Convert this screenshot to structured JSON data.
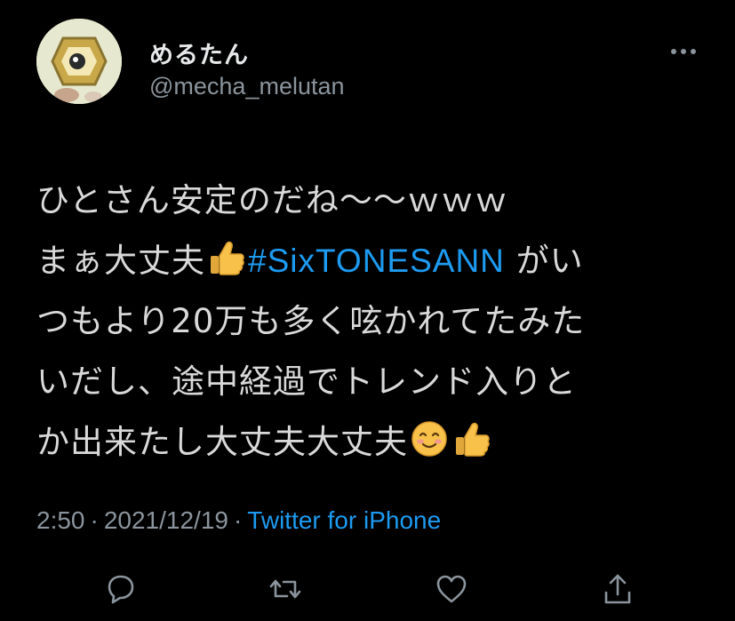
{
  "header": {
    "display_name": "めるたん",
    "handle": "@mecha_melutan",
    "more_label": "···"
  },
  "tweet": {
    "line1": "ひとさん安定のだね〜〜ｗｗｗ",
    "line2_prefix": "まぁ大丈夫",
    "hashtag": "#SixTONESANN",
    "line2_suffix": " がい",
    "line3": "つもより20万も多く呟かれてたみた",
    "line4": "いだし、途中経過でトレンド入りと",
    "line5": "か出来たし大丈夫大丈夫"
  },
  "meta": {
    "time": "2:50",
    "separator": "·",
    "date": "2021/12/19",
    "source": "Twitter for iPhone"
  },
  "actions": {
    "icons": [
      "reply-icon",
      "retweet-icon",
      "like-icon",
      "share-icon"
    ]
  },
  "colors": {
    "background": "#000000",
    "text": "#d9d9d9",
    "muted": "#8b949c",
    "accent": "#1d9bf0"
  }
}
